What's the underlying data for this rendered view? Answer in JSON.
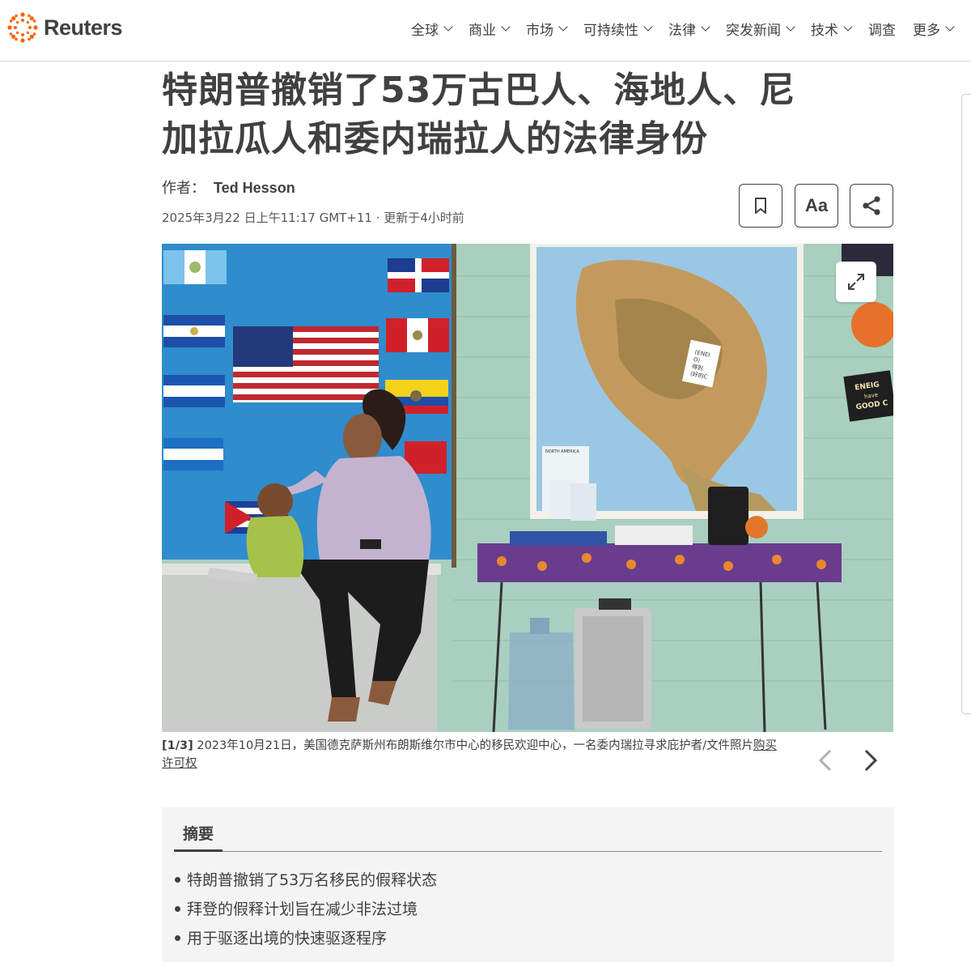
{
  "brand": {
    "name": "Reuters",
    "accent_color": "#fa6400"
  },
  "nav": [
    {
      "label": "全球",
      "has_menu": true
    },
    {
      "label": "商业",
      "has_menu": true
    },
    {
      "label": "市场",
      "has_menu": true
    },
    {
      "label": "可持续性",
      "has_menu": true
    },
    {
      "label": "法律",
      "has_menu": true
    },
    {
      "label": "突发新闻",
      "has_menu": true
    },
    {
      "label": "技术",
      "has_menu": true
    },
    {
      "label": "调查",
      "has_menu": false
    },
    {
      "label": "更多",
      "has_menu": true
    }
  ],
  "article": {
    "headline_line1": "特朗普撤销了53万古巴人、海地人、尼",
    "headline_line2": "加拉瓜人和委内瑞拉人的法律身份",
    "byline_prefix": "作者：",
    "author": "Ted Hesson",
    "dateline": "2025年3月22 日上午11:17 GMT+11 · 更新于4小时前",
    "tools": {
      "bookmark_icon": "bookmark-icon",
      "font_label": "Aa",
      "share_icon": "share-icon"
    }
  },
  "photo": {
    "counter": "[1/3]",
    "caption": " 2023年10月21日，美国德克萨斯州布朗斯维尔市中心的移民欢迎中心，一名委内瑞拉寻求庇护者/文件照片",
    "license_link": "购买许可权",
    "expand_icon": "expand-icon",
    "map_sticker_line1": "(ENEI",
    "map_sticker_line2": "O)",
    "map_sticker_line3": "得到",
    "map_sticker_line4": "(好的C",
    "map_label": "NORTH AMERICA",
    "poster_line1": "ENEIG",
    "poster_line2": "have",
    "poster_line3": "GOOD C"
  },
  "summary": {
    "tab_label": "摘要",
    "items": [
      "特朗普撤销了53万名移民的假释状态",
      "拜登的假释计划旨在减少非法过境",
      "用于驱逐出境的快速驱逐程序"
    ]
  }
}
